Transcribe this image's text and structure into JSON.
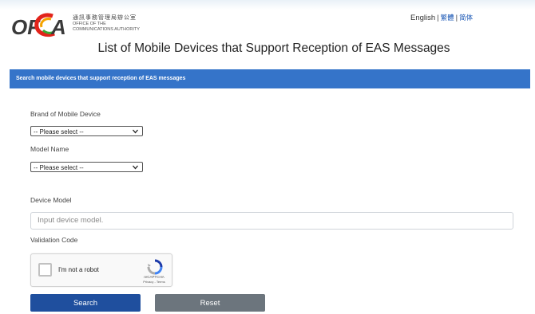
{
  "header": {
    "logo_text": "OFCA",
    "org_name_zh": "通訊事務管理局辦公室",
    "org_name_en_line1": "OFFICE OF THE",
    "org_name_en_line2": "COMMUNICATIONS AUTHORITY",
    "lang_english": "English",
    "lang_separator": "|",
    "lang_traditional": "繁體",
    "lang_simplified": "简体"
  },
  "page_title": "List of Mobile Devices that Support Reception of EAS Messages",
  "search_panel": {
    "heading": "Search mobile devices that support reception of EAS messages",
    "brand_label": "Brand of Mobile Device",
    "brand_selected": "-- Please select --",
    "model_name_label": "Model Name",
    "model_name_selected": "-- Please select --",
    "device_model_label": "Device Model",
    "device_model_placeholder": "Input device model.",
    "device_model_value": "",
    "validation_label": "Validation Code",
    "recaptcha": {
      "checkbox_label": "I'm not a robot",
      "brand": "reCAPTCHA",
      "links": "Privacy - Terms"
    },
    "search_button": "Search",
    "reset_button": "Reset"
  },
  "colors": {
    "panel_header": "#3574c9",
    "search_button": "#1f4f9e",
    "reset_button": "#6c757d",
    "lang_link": "#1a57b5"
  }
}
